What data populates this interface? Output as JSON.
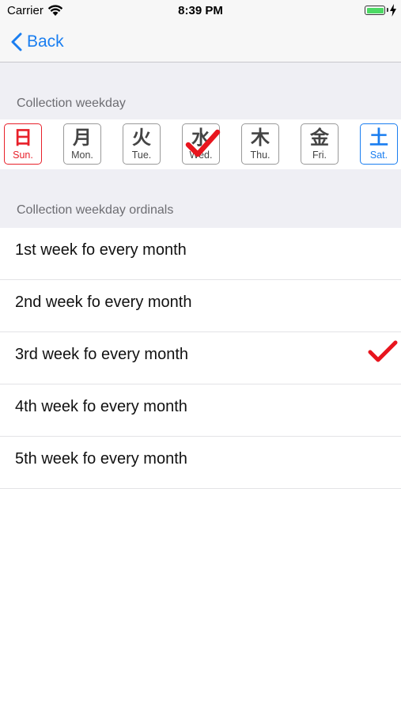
{
  "status_bar": {
    "carrier": "Carrier",
    "time": "8:39 PM",
    "battery_level": 1.0,
    "icons": [
      "wifi-icon",
      "battery-icon",
      "charging-bolt-icon"
    ]
  },
  "nav": {
    "back_label": "Back",
    "back_icon": "chevron-left-icon"
  },
  "colors": {
    "accent": "#1a7ef0",
    "sunday": "#e8202a",
    "saturday": "#1a7ef0",
    "checkmark": "#e8151e",
    "grouped_background": "#efeff4"
  },
  "weekday_section": {
    "header": "Collection weekday",
    "days": [
      {
        "kanji": "日",
        "abbr": "Sun.",
        "selected": false
      },
      {
        "kanji": "月",
        "abbr": "Mon.",
        "selected": false
      },
      {
        "kanji": "火",
        "abbr": "Tue.",
        "selected": false
      },
      {
        "kanji": "水",
        "abbr": "Wed.",
        "selected": true
      },
      {
        "kanji": "木",
        "abbr": "Thu.",
        "selected": false
      },
      {
        "kanji": "金",
        "abbr": "Fri.",
        "selected": false
      },
      {
        "kanji": "土",
        "abbr": "Sat.",
        "selected": false
      }
    ]
  },
  "ordinals_section": {
    "header": "Collection weekday ordinals",
    "rows": [
      {
        "label": "1st week fo every month",
        "checked": false
      },
      {
        "label": "2nd week fo every month",
        "checked": false
      },
      {
        "label": "3rd week fo every month",
        "checked": true
      },
      {
        "label": "4th week fo every month",
        "checked": false
      },
      {
        "label": "5th week fo every month",
        "checked": false
      }
    ]
  }
}
